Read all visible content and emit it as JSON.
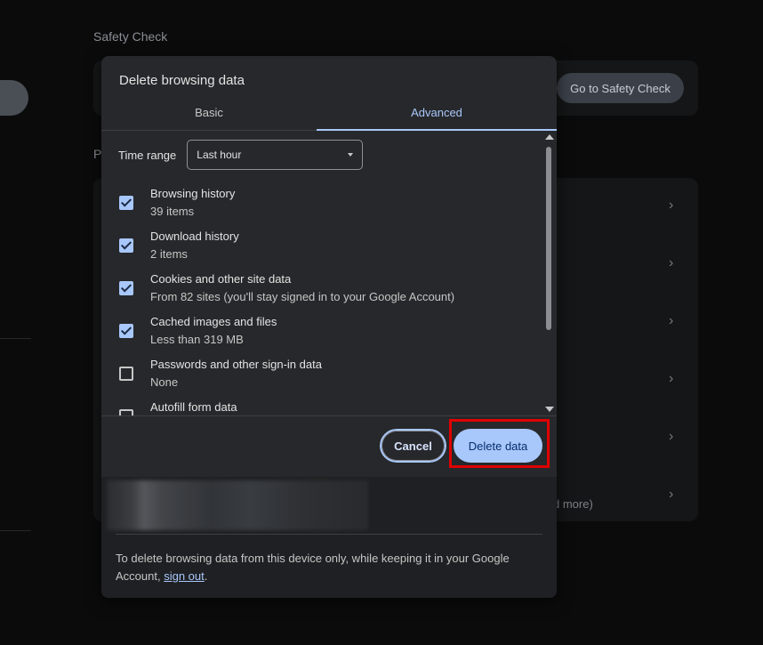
{
  "background": {
    "section_title": "Safety Check",
    "safety_button": "Go to Safety Check",
    "privacy_heading_partial": "P",
    "more_text": "d more)"
  },
  "dialog": {
    "title": "Delete browsing data",
    "tabs": [
      {
        "label": "Basic",
        "selected": false
      },
      {
        "label": "Advanced",
        "selected": true
      }
    ],
    "time_range": {
      "label": "Time range",
      "value": "Last hour"
    },
    "items": [
      {
        "title": "Browsing history",
        "subtitle": "39 items",
        "checked": true
      },
      {
        "title": "Download history",
        "subtitle": "2 items",
        "checked": true
      },
      {
        "title": "Cookies and other site data",
        "subtitle": "From 82 sites (you'll stay signed in to your Google Account)",
        "checked": true
      },
      {
        "title": "Cached images and files",
        "subtitle": "Less than 319 MB",
        "checked": true
      },
      {
        "title": "Passwords and other sign-in data",
        "subtitle": "None",
        "checked": false
      },
      {
        "title": "Autofill form data",
        "subtitle": "",
        "checked": false
      }
    ],
    "buttons": {
      "cancel": "Cancel",
      "delete": "Delete data"
    },
    "footer": {
      "text": "To delete browsing data from this device only, while keeping it in your Google Account,",
      "link": "sign out",
      "end": "."
    }
  },
  "colors": {
    "accent": "#a8c7fa",
    "highlight": "#e00000"
  }
}
